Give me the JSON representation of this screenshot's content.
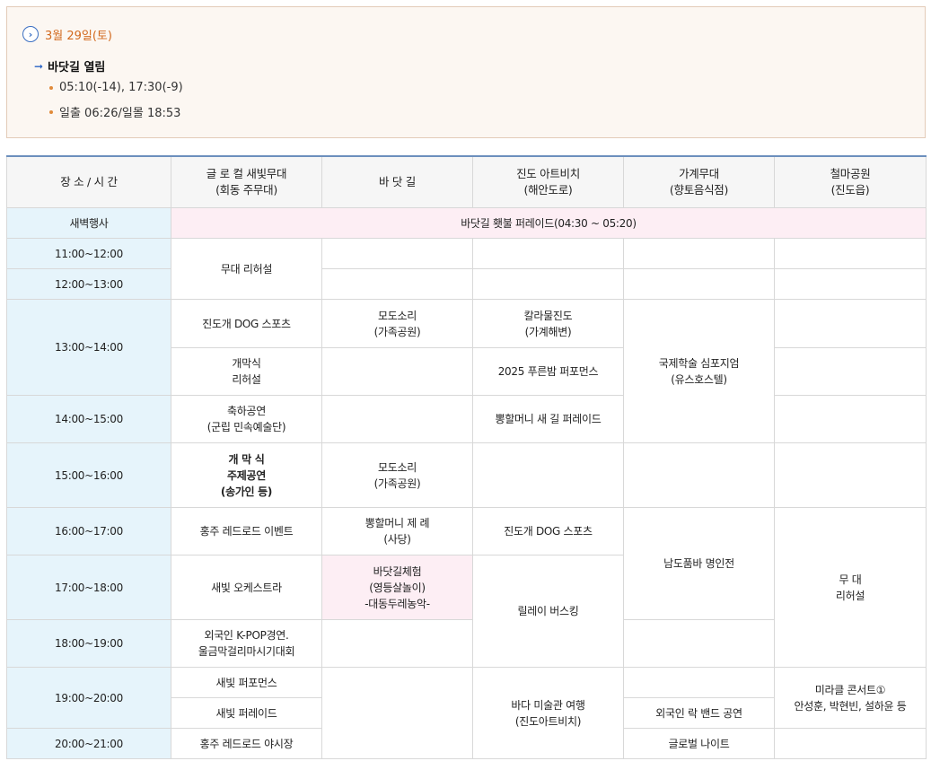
{
  "info": {
    "date": "3월 29일(토)",
    "tide_title": "바닷길 열림",
    "bullets": [
      "05:10(-14), 17:30(-9)",
      "일출 06:26/일몰 18:53"
    ]
  },
  "table": {
    "headers": [
      "장 소 / 시 간",
      "글 로 컬 새빛무대\n(회동 주무대)",
      "바 닷 길",
      "진도 아트비치\n(해안도로)",
      "가계무대\n(향토음식점)",
      "철마공원\n(진도읍)"
    ],
    "times": {
      "dawn": "새벽행사",
      "t11": "11:00~12:00",
      "t12": "12:00~13:00",
      "t13": "13:00~14:00",
      "t14": "14:00~15:00",
      "t15": "15:00~16:00",
      "t16": "16:00~17:00",
      "t17": "17:00~18:00",
      "t18": "18:00~19:00",
      "t19": "19:00~20:00",
      "t20": "20:00~21:00"
    },
    "cells": {
      "dawn_event": "바닷길 횃불 퍼레이드(04:30 ~ 05:20)",
      "rehearsal1": "무대 리허설",
      "dog_sports1": "진도개 DOG 스포츠",
      "modosori1": "모도소리\n(가족공원)",
      "kalaul": "칼라물진도\n(가계해변)",
      "symposium": "국제학술 심포지엄\n(유스호스텔)",
      "opening_rehearsal": "개막식\n리허설",
      "pureunbam": "2025 푸른밤 퍼포먼스",
      "chukha": "축하공연\n(군립 민속예술단)",
      "ppong1": "뽕할머니 새 길 퍼레이드",
      "opening_main": "개 막 식\n주제공연\n(송가인 등)",
      "modosori2": "모도소리\n(가족공원)",
      "hongju_red": "홍주 레드로드 이벤트",
      "ppong_rite": "뽕할머니 제 례\n(사당)",
      "dog_sports2": "진도개 DOG 스포츠",
      "namdo": "남도품바 명인전",
      "stage_rehearsal": "무 대\n리허설",
      "orchestra": "새빛 오케스트라",
      "sea_experience": "바닷길체험\n(영등살놀이)\n-대동두레농악-",
      "relay": "릴레이 버스킹",
      "kpop": "외국인 K-POP경연.\n울금막걸리마시기대회",
      "performance": "새빛 퍼포먼스",
      "art_museum": "바다 미술관 여행\n(진도아트비치)",
      "miracle": "미라클 콘서트①\n안성훈, 박현빈, 설하윤 등",
      "parade": "새빛 퍼레이드",
      "rock_band": "외국인 락 밴드 공연",
      "night_market": "홍주 레드로드 야시장",
      "global_night": "글로벌 나이트"
    }
  }
}
